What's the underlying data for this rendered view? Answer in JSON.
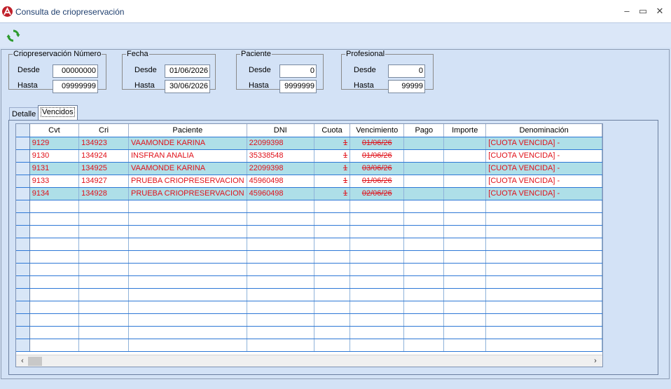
{
  "window": {
    "title": "Consulta de criopreservación",
    "minimize": "–",
    "maximize": "▭",
    "close": "✕"
  },
  "filters": {
    "cryo": {
      "legend": "Criopreservación Número",
      "from_label": "Desde",
      "from_value": "00000000",
      "to_label": "Hasta",
      "to_value": "09999999"
    },
    "date": {
      "legend": "Fecha",
      "from_label": "Desde",
      "from_value": "01/06/2026",
      "to_label": "Hasta",
      "to_value": "30/06/2026"
    },
    "patient": {
      "legend": "Paciente",
      "from_label": "Desde",
      "from_value": "0",
      "to_label": "Hasta",
      "to_value": "9999999"
    },
    "professional": {
      "legend": "Profesional",
      "from_label": "Desde",
      "from_value": "0",
      "to_label": "Hasta",
      "to_value": "99999"
    }
  },
  "tabs": [
    {
      "label": "Detalle"
    },
    {
      "label": "Vencidos"
    }
  ],
  "grid": {
    "headers": [
      "Cvt",
      "Cri",
      "Paciente",
      "DNI",
      "Cuota",
      "Vencimiento",
      "Pago",
      "Importe",
      "Denominación"
    ],
    "rows": [
      [
        "9129",
        "134923",
        " VAAMONDE KARINA",
        "22099398",
        "1",
        "01/06/26",
        "",
        "",
        "[CUOTA VENCIDA] -"
      ],
      [
        "9130",
        "134924",
        "INSFRAN ANALIA",
        "35338548",
        "1",
        "01/06/26",
        "",
        "",
        "[CUOTA VENCIDA] -"
      ],
      [
        "9131",
        "134925",
        " VAAMONDE KARINA",
        "22099398",
        "1",
        "03/06/26",
        "",
        "",
        "[CUOTA VENCIDA] -"
      ],
      [
        "9133",
        "134927",
        "PRUEBA CRIOPRESERVACION",
        "45960498",
        "1",
        "01/06/26",
        "",
        "",
        "[CUOTA VENCIDA] -"
      ],
      [
        "9134",
        "134928",
        "PRUEBA CRIOPRESERVACION",
        "45960498",
        "1",
        "02/06/26",
        "",
        "",
        "[CUOTA VENCIDA] -"
      ]
    ]
  },
  "scrollbar": {
    "left": "‹",
    "right": "›"
  },
  "colors": {
    "row_highlight": "#aedfe8",
    "text_overdue": "#e0111a",
    "grid_line": "#2e78d6"
  },
  "icons": {
    "app": "app-logo-icon",
    "refresh": "refresh-icon"
  }
}
